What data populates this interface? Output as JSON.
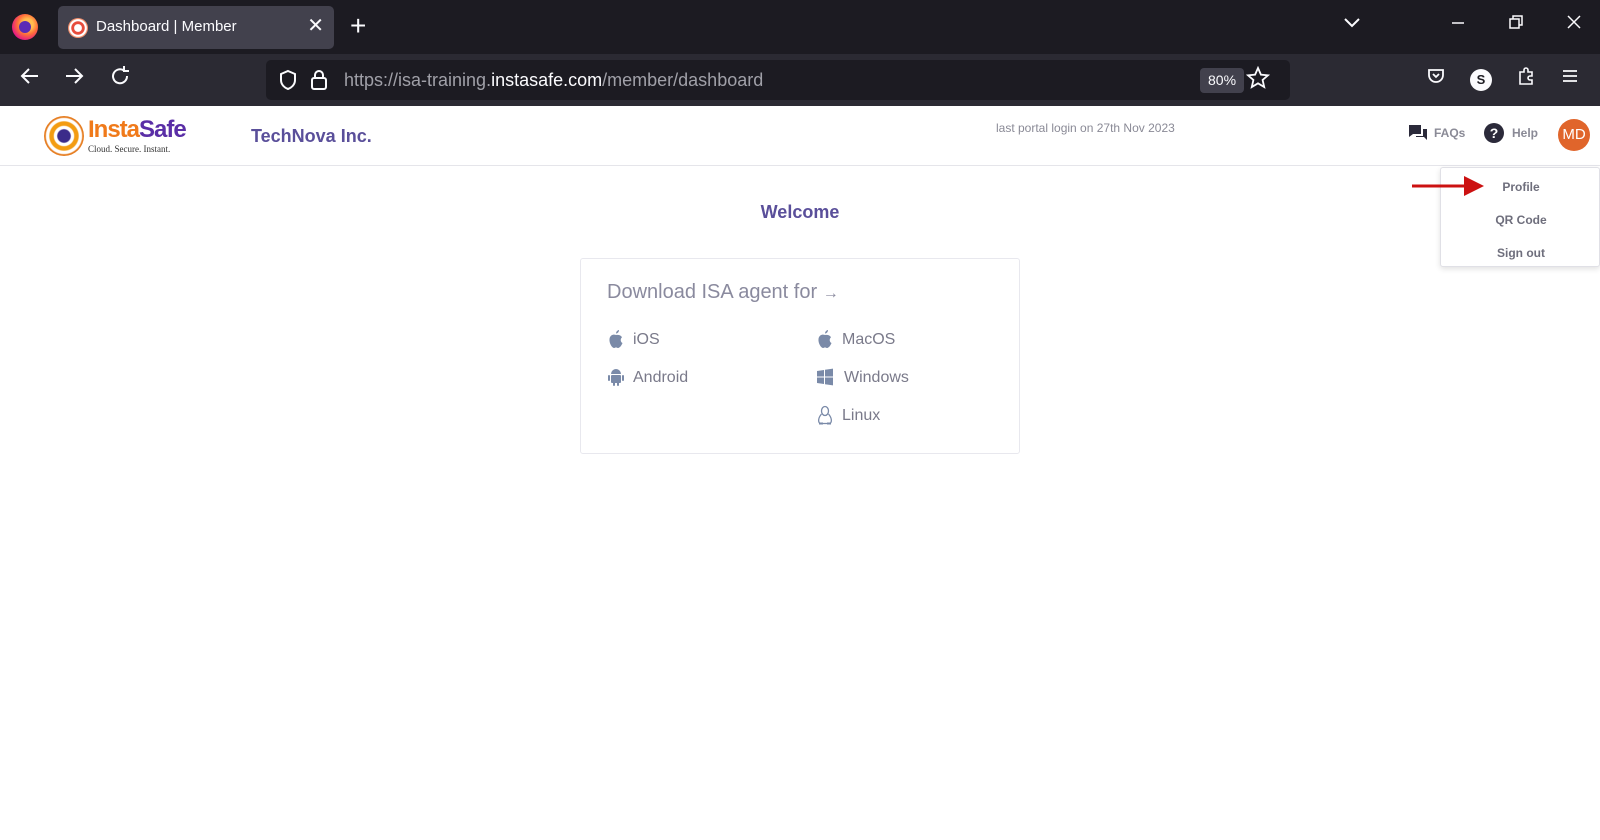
{
  "browser": {
    "tab_title": "Dashboard | Member",
    "tab_close": "✕",
    "new_tab": "+",
    "url_prefix": "https://isa-training.",
    "url_host": "instasafe.com",
    "url_path": "/member/dashboard",
    "zoom": "80%",
    "profile_initial": "S"
  },
  "header": {
    "logo_insta": "Insta",
    "logo_safe": "Safe",
    "logo_tagline": "Cloud. Secure. Instant.",
    "company": "TechNova Inc.",
    "last_login": "last portal login on 27th Nov 2023",
    "faqs": "FAQs",
    "help": "Help",
    "avatar_initials": "MD"
  },
  "dropdown": {
    "items": [
      "Profile",
      "QR Code",
      "Sign out"
    ]
  },
  "main": {
    "welcome": "Welcome",
    "download_title": "Download ISA agent for",
    "download_arrow": "→",
    "os": {
      "ios": "iOS",
      "macos": "MacOS",
      "android": "Android",
      "windows": "Windows",
      "linux": "Linux"
    }
  },
  "colors": {
    "accent": "#5a4f9a",
    "avatar": "#e0652b",
    "arrow": "#cc1111"
  }
}
